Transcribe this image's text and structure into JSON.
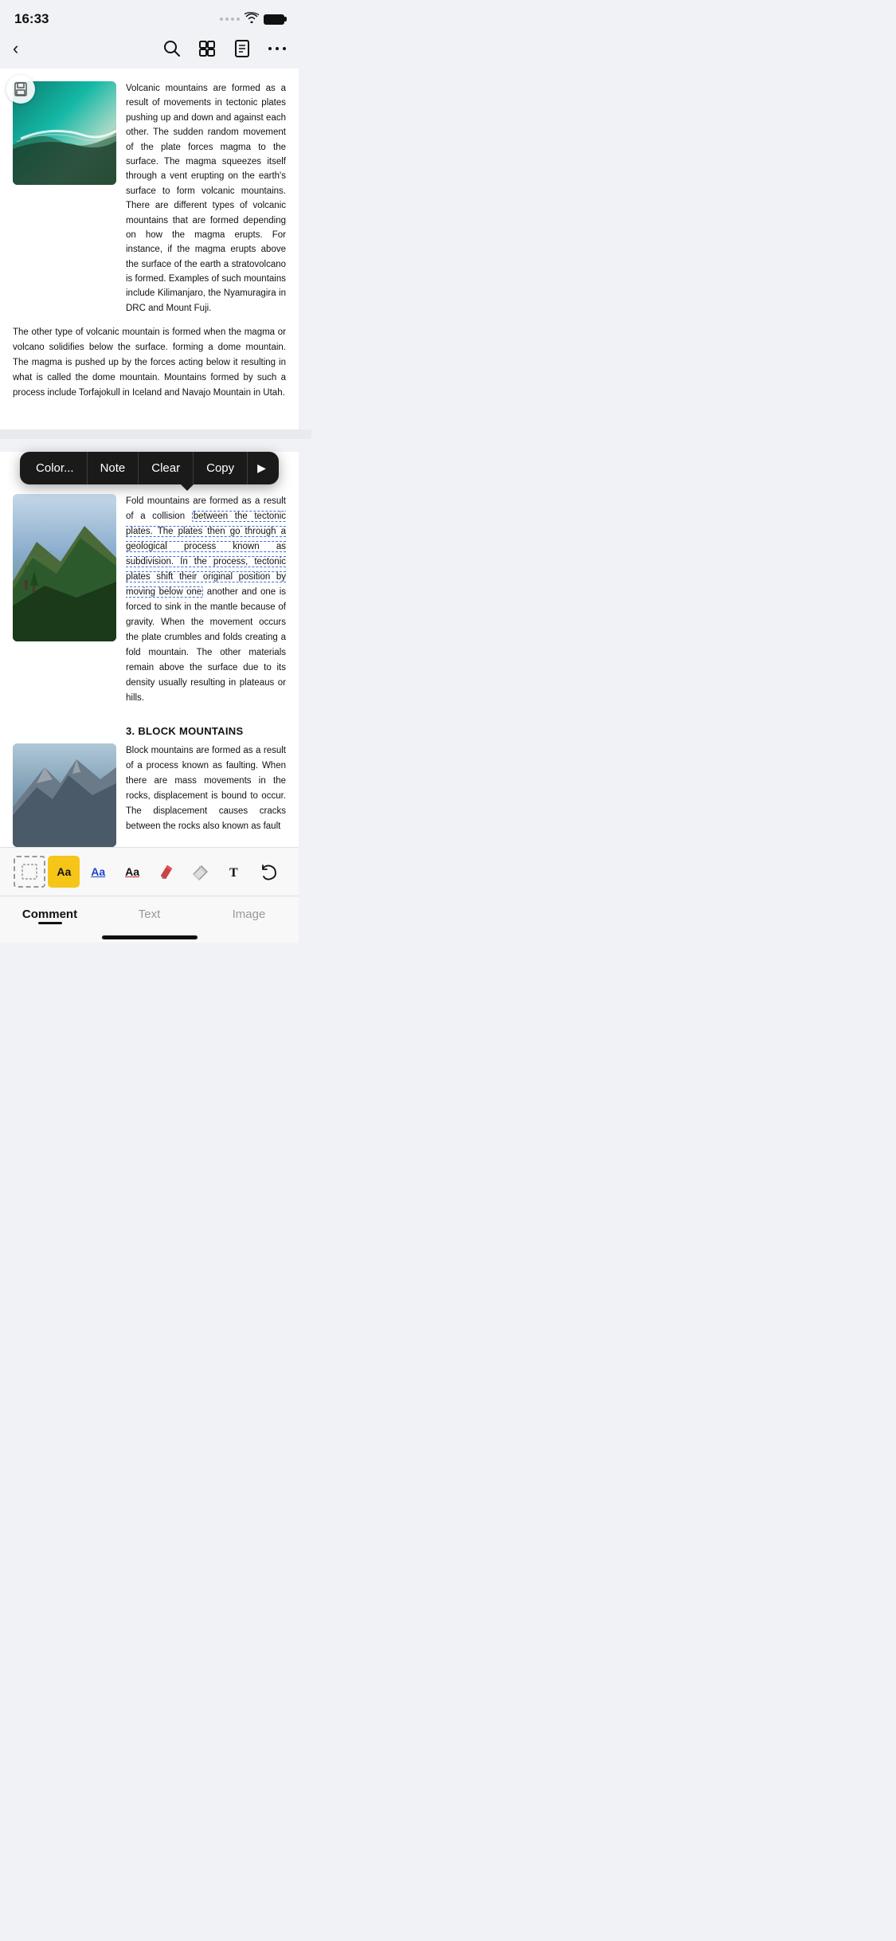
{
  "statusBar": {
    "time": "16:33"
  },
  "toolbar": {
    "backLabel": "‹",
    "searchLabel": "⌕",
    "gridLabel": "⊞",
    "docLabel": "☰",
    "moreLabel": "···"
  },
  "contextMenu": {
    "color": "Color...",
    "note": "Note",
    "clear": "Clear",
    "copy": "Copy",
    "arrow": "▶"
  },
  "bottomTabs": {
    "comment": "Comment",
    "text": "Text",
    "image": "Image"
  },
  "annotationTools": {
    "selection": "",
    "highlight": "Aa",
    "underline": "Aa",
    "text": "Aa"
  },
  "content": {
    "section1": {
      "text": "Volcanic mountains are formed as a result of movements in tectonic plates pushing up and down and against each other. The sudden random movement of the plate forces magma to the surface. The magma squeezes itself through a vent erupting on the earth's surface to form volcanic mountains. There are different types of volcanic mountains that are formed depending on how the magma erupts. For instance, if the magma erupts above the surface of the earth a stratovolcano is formed. Examples of such mountains include Kilimanjaro, the Nyamuragira in DRC and Mount Fuji."
    },
    "section1bottom": {
      "text": "The other type of volcanic mountain is formed when the magma or volcano solidifies below the surface. forming a dome mountain. The magma is pushed up by the forces acting below it resulting in what is called the dome mountain. Mountains formed by such a process include Torfajokull in Iceland and Navajo Mountain in Utah."
    },
    "section2": {
      "text1": "Fold mountains are formed as a result of a collision ",
      "highlight1": "between the tectonic plates. The plates then go through a geological process known as subdivision. In the process, tectonic plates shift their original position by moving below one",
      "text2": " another and one is forced to sink in the mantle because of gravity. When the movement occurs the plate crumbles and folds creating a fold mountain. The other materials remain above the surface due to its density usually resulting in plateaus or hills."
    },
    "section3": {
      "header": "3. BLOCK MOUNTAINS",
      "text": "Block mountains are formed as a result of a process known as faulting. When there are mass movements in the rocks, displacement is bound to occur. The displacement causes cracks between the rocks also known as fault"
    }
  }
}
